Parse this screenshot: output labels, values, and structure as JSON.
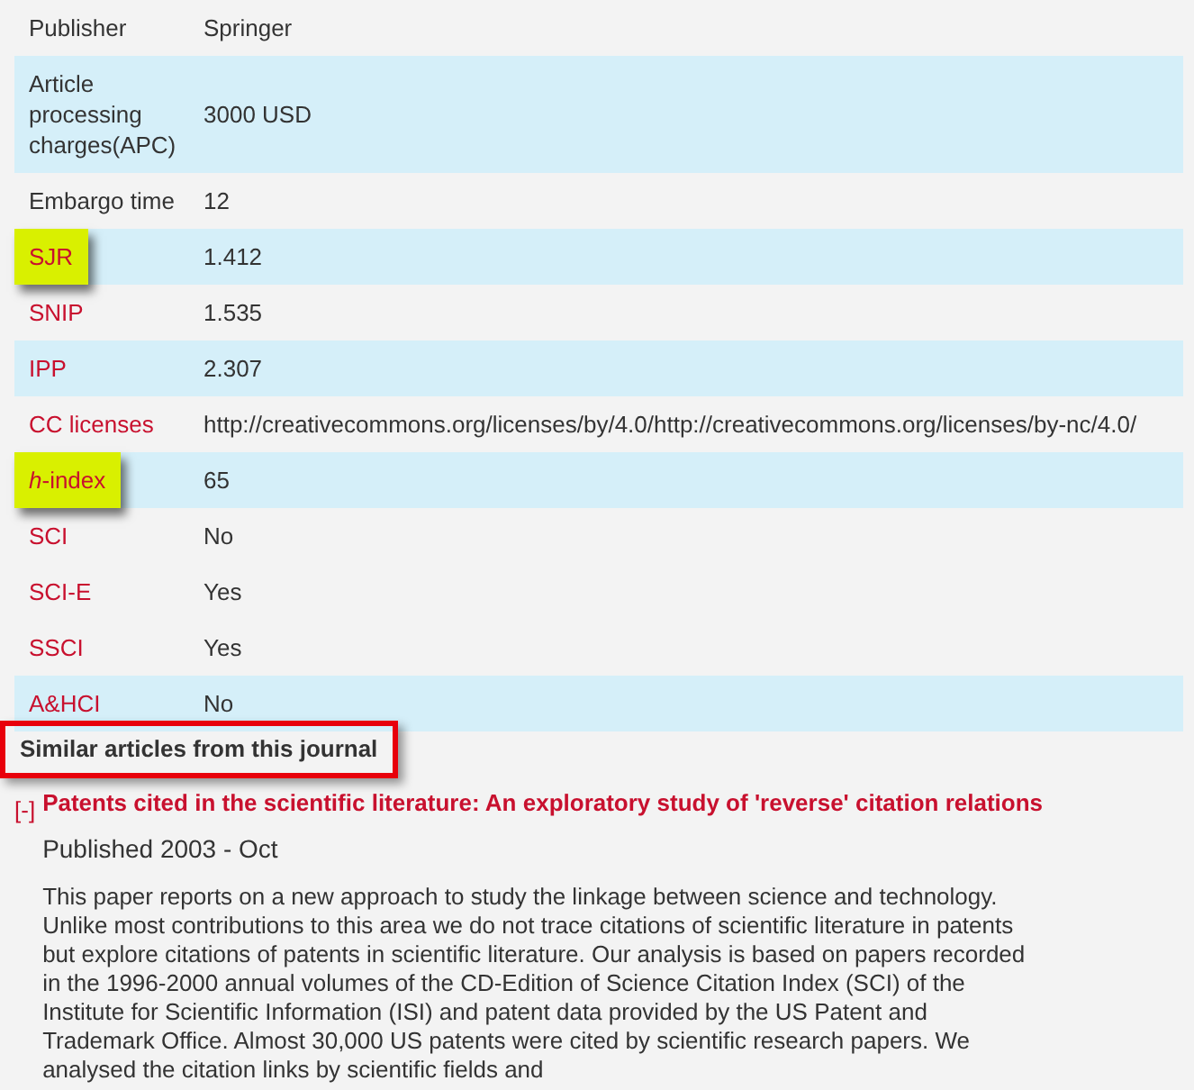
{
  "details": [
    {
      "label": "Publisher",
      "kind": "plain",
      "value": "Springer",
      "shaded": false,
      "highlighted": false
    },
    {
      "label": "Article processing charges(APC)",
      "kind": "plain",
      "value": "3000 USD",
      "shaded": true,
      "highlighted": false
    },
    {
      "label": "Embargo time",
      "kind": "plain",
      "value": "12",
      "shaded": false,
      "highlighted": false
    },
    {
      "label": "SJR",
      "kind": "link",
      "value": "1.412",
      "shaded": true,
      "highlighted": true
    },
    {
      "label": "SNIP",
      "kind": "link",
      "value": "1.535",
      "shaded": false,
      "highlighted": false
    },
    {
      "label": "IPP",
      "kind": "link",
      "value": "2.307",
      "shaded": true,
      "highlighted": false
    },
    {
      "label": "CC licenses",
      "kind": "link",
      "value": "http://creativecommons.org/licenses/by/4.0/http://creativecommons.org/licenses/by-nc/4.0/",
      "shaded": false,
      "highlighted": false
    },
    {
      "label": "*h*-index",
      "kind": "link",
      "value": "65",
      "shaded": true,
      "highlighted": true
    },
    {
      "label": "SCI",
      "kind": "link",
      "value": "No",
      "shaded": false,
      "highlighted": false
    },
    {
      "label": "SCI-E",
      "kind": "link",
      "value": "Yes",
      "shaded": false,
      "highlighted": false
    },
    {
      "label": "SSCI",
      "kind": "link",
      "value": "Yes",
      "shaded": false,
      "highlighted": false
    },
    {
      "label": "A&HCI",
      "kind": "link",
      "value": "No",
      "shaded": true,
      "highlighted": false
    }
  ],
  "similar": {
    "heading": "Similar articles from this journal",
    "boxed": true,
    "articles": [
      {
        "toggle": "[-]",
        "expanded": true,
        "title": "Patents cited in the scientific literature: An exploratory study of 'reverse' citation relations",
        "published": "Published 2003 - Oct",
        "abstract": "This paper reports on a new approach to study the linkage between science and technology. Unlike most contributions to this area we do not trace citations of scientific literature in patents but explore citations of patents in scientific literature. Our analysis is based on papers recorded in the 1996-2000 annual volumes of the CD-Edition of Science Citation Index (SCI) of the Institute for Scientific Information (ISI) and patent data provided by the US Patent and Trademark Office. Almost 30,000 US patents were cited by scientific research papers. We analysed the citation links by scientific fields and"
      }
    ]
  }
}
